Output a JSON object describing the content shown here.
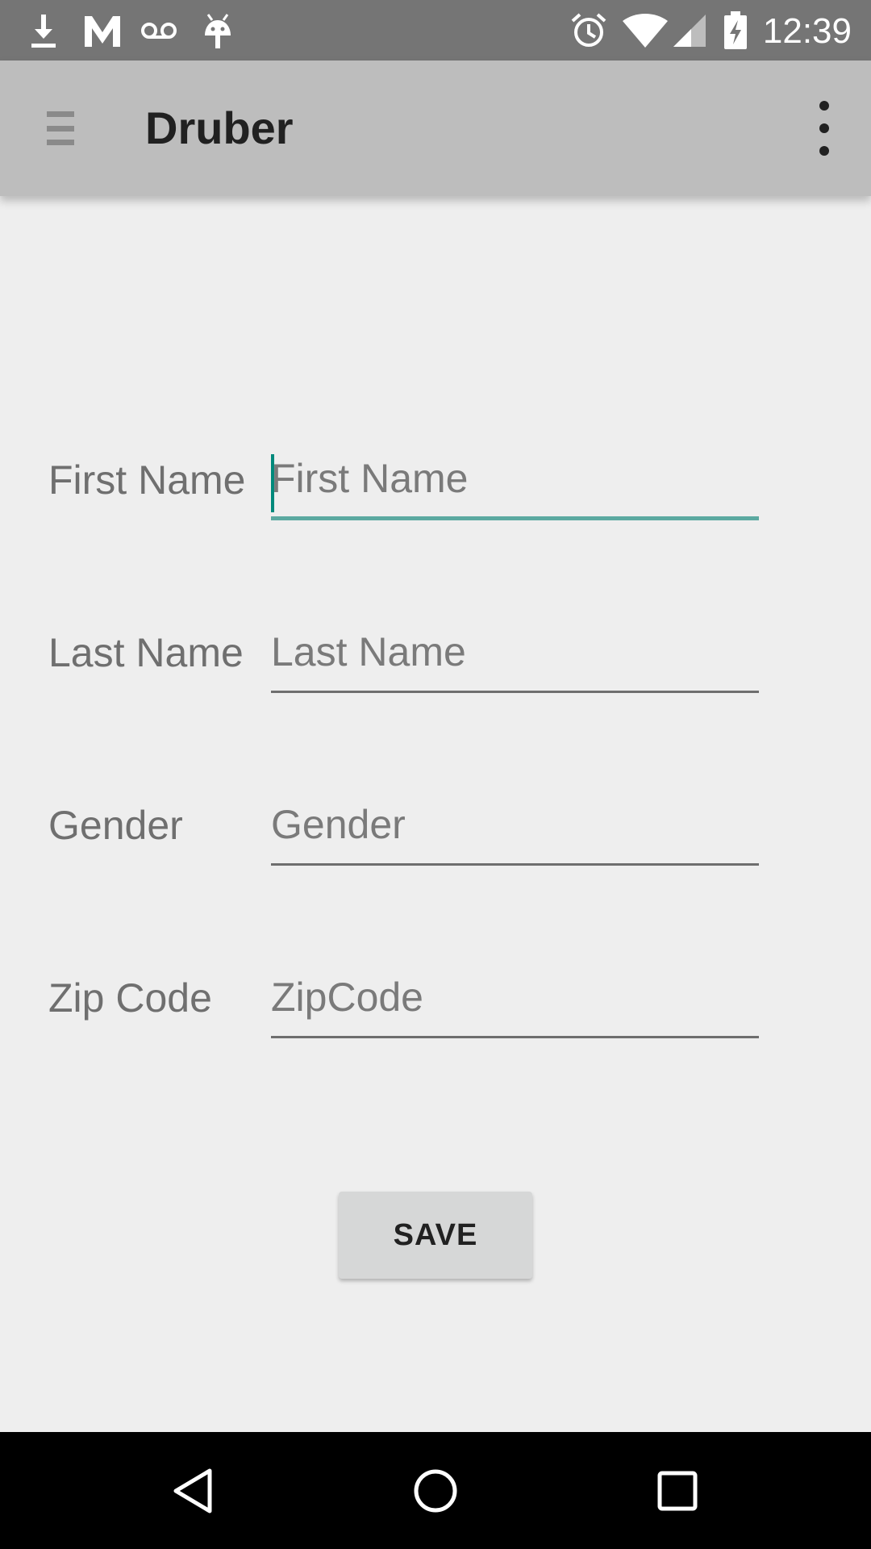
{
  "status_bar": {
    "time": "12:39",
    "left_icons": [
      "download-icon",
      "gmail-icon",
      "voicemail-icon",
      "android-debug-icon"
    ],
    "right_icons": [
      "alarm-icon",
      "wifi-icon",
      "cell-signal-icon",
      "battery-charging-icon"
    ]
  },
  "toolbar": {
    "title": "Druber",
    "nav_icon": "menu-icon",
    "overflow_icon": "more-vert-icon"
  },
  "form": {
    "fields": [
      {
        "label": "First Name",
        "placeholder": "First Name",
        "value": ""
      },
      {
        "label": "Last Name",
        "placeholder": "Last Name",
        "value": ""
      },
      {
        "label": "Gender",
        "placeholder": "Gender",
        "value": ""
      },
      {
        "label": "Zip Code",
        "placeholder": "ZipCode",
        "value": ""
      }
    ],
    "save_label": "SAVE"
  },
  "colors": {
    "status_bar": "#757575",
    "toolbar": "#bdbdbd",
    "background": "#eeeeee",
    "accent": "#00897b",
    "button": "#d6d7d7"
  },
  "nav_bar": {
    "buttons": [
      "back-icon",
      "home-icon",
      "recents-icon"
    ]
  }
}
